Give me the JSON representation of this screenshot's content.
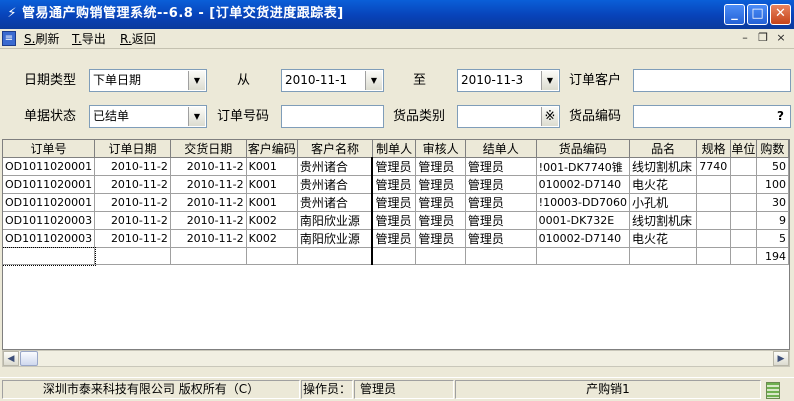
{
  "window": {
    "title": "管易通产购销管理系统--6.8 - [订单交货进度跟踪表]"
  },
  "menu": {
    "refresh": {
      "key": "S.",
      "label": "刷新"
    },
    "export": {
      "key": "T.",
      "label": "导出"
    },
    "back": {
      "key": "R.",
      "label": "返回"
    }
  },
  "filters": {
    "date_type_label": "日期类型",
    "date_type_value": "下单日期",
    "from_label": "从",
    "from_value": "2010-11-1",
    "to_label": "至",
    "to_value": "2010-11-3",
    "customer_label": "订单客户",
    "customer_value": "",
    "status_label": "单据状态",
    "status_value": "已结单",
    "order_no_label": "订单号码",
    "order_no_value": "",
    "category_label": "货品类别",
    "category_value": "",
    "product_code_label": "货品编码",
    "product_code_value": "",
    "lookup_glyph": "※",
    "help_glyph": "?"
  },
  "grid": {
    "columns": [
      "订单号",
      "订单日期",
      "交货日期",
      "客户编码",
      "客户名称",
      "制单人",
      "审核人",
      "结单人",
      "货品编码",
      "品名",
      "规格",
      "单位",
      "购数"
    ],
    "rows": [
      [
        "OD1011020001",
        "2010-11-2",
        "2010-11-2",
        "K001",
        "贵州诸合",
        "管理员",
        "管理员",
        "管理员",
        "!001-DK7740锥",
        "线切割机床",
        "7740",
        "",
        "50"
      ],
      [
        "OD1011020001",
        "2010-11-2",
        "2010-11-2",
        "K001",
        "贵州诸合",
        "管理员",
        "管理员",
        "管理员",
        "010002-D7140",
        "电火花",
        "",
        "",
        "100"
      ],
      [
        "OD1011020001",
        "2010-11-2",
        "2010-11-2",
        "K001",
        "贵州诸合",
        "管理员",
        "管理员",
        "管理员",
        "!10003-DD7060",
        "小孔机",
        "",
        "",
        "30"
      ],
      [
        "OD1011020003",
        "2010-11-2",
        "2010-11-2",
        "K002",
        "南阳欣业源",
        "管理员",
        "管理员",
        "管理员",
        "0001-DK732E",
        "线切割机床",
        "",
        "",
        "9"
      ],
      [
        "OD1011020003",
        "2010-11-2",
        "2010-11-2",
        "K002",
        "南阳欣业源",
        "管理员",
        "管理员",
        "管理员",
        "010002-D7140",
        "电火花",
        "",
        "",
        "5"
      ],
      [
        "",
        "",
        "",
        "",
        "",
        "",
        "",
        "",
        "",
        "",
        "",
        "",
        "194"
      ]
    ]
  },
  "status": {
    "company": "深圳市泰来科技有限公司 版权所有（C）",
    "operator_label": "操作员：",
    "operator": "管理员",
    "module": "产购销1"
  },
  "colors": {
    "titlebar": "#0842b8",
    "chrome": "#ece9d8"
  }
}
